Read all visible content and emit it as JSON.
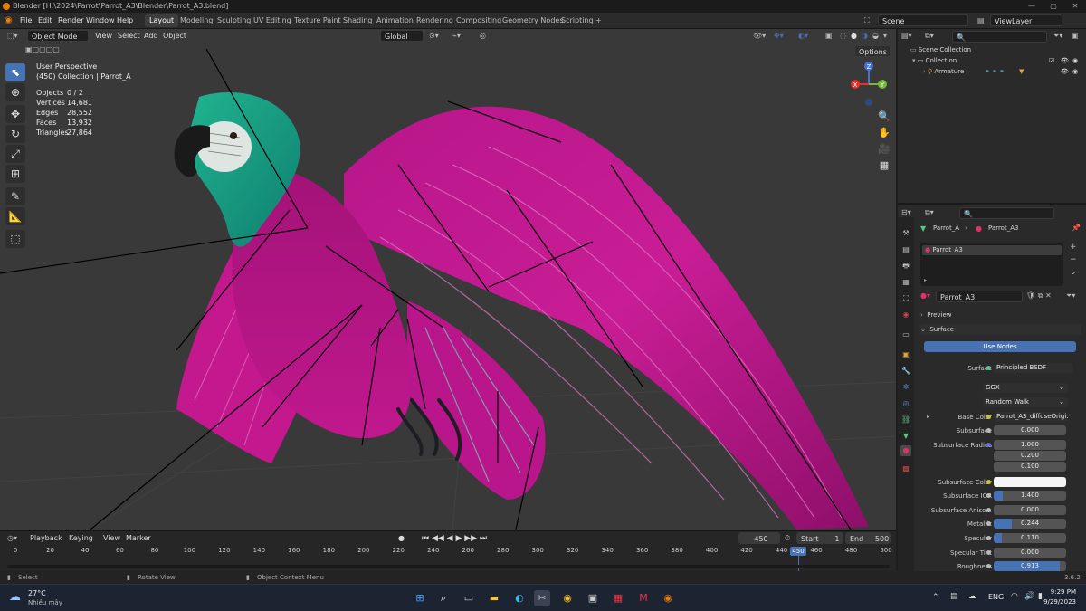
{
  "title_bar": {
    "title": "Blender [H:\\2024\\Parrot\\Parrot_A3\\Blender\\Parrot_A3.blend]",
    "minimize": "—",
    "maximize": "▢",
    "close": "✕"
  },
  "menu": {
    "file": "File",
    "edit": "Edit",
    "render": "Render",
    "window": "Window",
    "help": "Help"
  },
  "workspaces": [
    "Layout",
    "Modeling",
    "Sculpting",
    "UV Editing",
    "Texture Paint",
    "Shading",
    "Animation",
    "Rendering",
    "Compositing",
    "Geometry Nodes",
    "Scripting"
  ],
  "add_workspace": "+",
  "scene": {
    "name": "Scene",
    "view_layer": "ViewLayer"
  },
  "viewport_header": {
    "mode": "Object Mode",
    "view": "View",
    "select": "Select",
    "add": "Add",
    "object": "Object",
    "orientation": "Global",
    "options": "Options"
  },
  "viewport_info": {
    "perspective": "User Perspective",
    "collection": "(450) Collection | Parrot_A"
  },
  "stats": [
    {
      "label": "Objects",
      "value": "0 / 2"
    },
    {
      "label": "Vertices",
      "value": "14,681"
    },
    {
      "label": "Edges",
      "value": "28,552"
    },
    {
      "label": "Faces",
      "value": "13,932"
    },
    {
      "label": "Triangles",
      "value": "27,864"
    }
  ],
  "gizmo": {
    "x": "X",
    "y": "Y",
    "z": "Z"
  },
  "timeline": {
    "playback": "Playback",
    "keying": "Keying",
    "view": "View",
    "marker": "Marker",
    "current_frame": "450",
    "start_label": "Start",
    "start": "1",
    "end_label": "End",
    "end": "500",
    "ticks": [
      "0",
      "20",
      "40",
      "60",
      "80",
      "100",
      "120",
      "140",
      "160",
      "180",
      "200",
      "220",
      "240",
      "260",
      "280",
      "300",
      "320",
      "340",
      "360",
      "380",
      "400",
      "420",
      "440",
      "460",
      "480",
      "500"
    ],
    "playhead": "450"
  },
  "status_bar": {
    "select": "Select",
    "rotate": "Rotate View",
    "context": "Object Context Menu",
    "version": "3.6.2"
  },
  "outliner": {
    "scene_collection": "Scene Collection",
    "collection": "Collection",
    "armature": "Armature"
  },
  "properties": {
    "breadcrumb_object": "Parrot_A",
    "breadcrumb_material": "Parrot_A3",
    "slot": "Parrot_A3",
    "material_name": "Parrot_A3",
    "preview": "Preview",
    "surface_panel": "Surface",
    "use_nodes": "Use Nodes",
    "rows": [
      {
        "label": "Surface",
        "value": "Principled BSDF"
      },
      {
        "label": "",
        "value": "GGX"
      },
      {
        "label": "",
        "value": "Random Walk"
      },
      {
        "label": "Base Color",
        "value": "Parrot_A3_diffuseOrigi..."
      },
      {
        "label": "Subsurface",
        "value": "0.000"
      },
      {
        "label": "Subsurface Radius",
        "value": "1.000"
      },
      {
        "label": "",
        "value": "0.200"
      },
      {
        "label": "",
        "value": "0.100"
      },
      {
        "label": "Subsurface Color",
        "value": ""
      },
      {
        "label": "Subsurface IOR",
        "value": "1.400"
      },
      {
        "label": "Subsurface Aniso...",
        "value": "0.000"
      },
      {
        "label": "Metallic",
        "value": "0.244"
      },
      {
        "label": "Specular",
        "value": "0.110"
      },
      {
        "label": "Specular Tint",
        "value": "0.000"
      },
      {
        "label": "Roughness",
        "value": "0.913"
      }
    ],
    "fills": {
      "subsurface_ior": 0.12,
      "metallic": 0.244,
      "specular": 0.11,
      "roughness": 0.913
    }
  },
  "taskbar": {
    "temperature": "27°C",
    "weather": "Nhiều mây",
    "language": "ENG",
    "time": "9:29 PM",
    "date": "9/29/2023"
  },
  "colors": {
    "accent": "#4772b3",
    "parrot_pink": "#c8178f",
    "parrot_teal": "#1aa58a",
    "viewport_bg": "#393939"
  }
}
